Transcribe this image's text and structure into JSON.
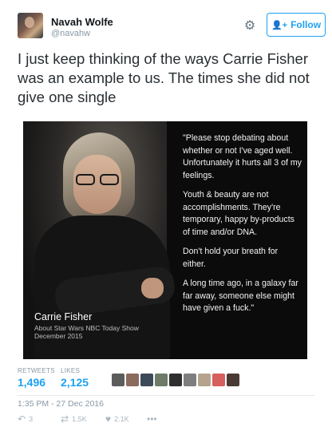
{
  "user": {
    "display_name": "Navah Wolfe",
    "handle": "@navahw",
    "avatar_icon": "profile-avatar"
  },
  "header": {
    "settings_icon": "gear-icon",
    "follow_label": "Follow",
    "follow_icon": "add-person-icon",
    "accent_color": "#1da1f2"
  },
  "tweet": {
    "text": "I just keep thinking of the ways Carrie Fisher was an example to us. The times she did not give one single"
  },
  "media": {
    "caption_name": "Carrie Fisher",
    "caption_about_1": "About Star Wars  NBC Today Show",
    "caption_about_2": "December 2015",
    "quote": [
      "\"Please stop debating about whether or not I've aged well. Unfortunately it hurts all 3 of my feelings.",
      "Youth & beauty are not accomplishments. They're temporary, happy by-products of time and/or DNA.",
      "Don't hold your breath for either.",
      "A long time ago, in a galaxy far far away, someone else might have given a fuck.\""
    ]
  },
  "stats": {
    "retweets_label": "RETWEETS",
    "retweets_value": "1,496",
    "likes_label": "LIKES",
    "likes_value": "2,125"
  },
  "timestamp": "1:35 PM - 27 Dec 2016",
  "actions": {
    "reply_count": "3",
    "retweet_count": "1.5K",
    "like_count": "2.1K",
    "reply_icon": "reply-icon",
    "retweet_icon": "retweet-icon",
    "like_icon": "heart-icon",
    "more_icon": "more-icon"
  }
}
